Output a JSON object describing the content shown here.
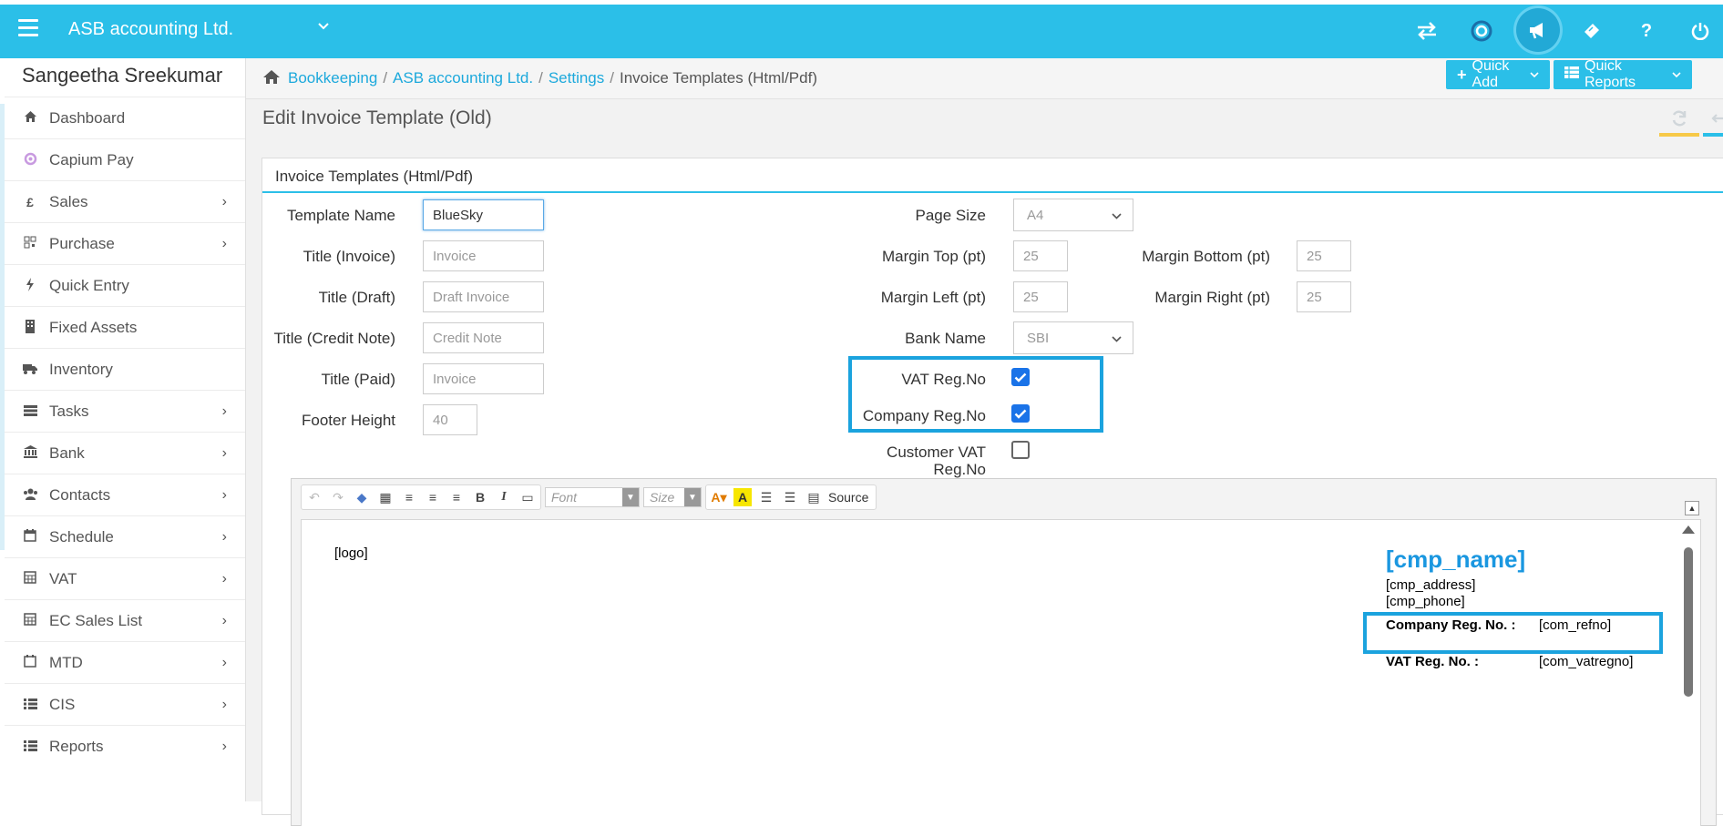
{
  "header": {
    "company": "ASB accounting Ltd.",
    "icons": [
      "exchange-icon",
      "capium-icon",
      "megaphone-icon",
      "ticket-icon",
      "help-icon",
      "power-icon"
    ]
  },
  "sidebar": {
    "user_name": "Sangeetha Sreekumar",
    "items": [
      {
        "label": "Dashboard",
        "icon": "home-icon",
        "submenu": false
      },
      {
        "label": "Capium Pay",
        "icon": "capium-icon",
        "submenu": false
      },
      {
        "label": "Sales",
        "icon": "pound-icon",
        "submenu": true
      },
      {
        "label": "Purchase",
        "icon": "barcode-icon",
        "submenu": true
      },
      {
        "label": "Quick Entry",
        "icon": "bolt-icon",
        "submenu": false
      },
      {
        "label": "Fixed Assets",
        "icon": "building-icon",
        "submenu": false
      },
      {
        "label": "Inventory",
        "icon": "truck-icon",
        "submenu": false
      },
      {
        "label": "Tasks",
        "icon": "tasks-icon",
        "submenu": true
      },
      {
        "label": "Bank",
        "icon": "bank-icon",
        "submenu": true
      },
      {
        "label": "Contacts",
        "icon": "users-icon",
        "submenu": true
      },
      {
        "label": "Schedule",
        "icon": "calendar-icon",
        "submenu": true
      },
      {
        "label": "VAT",
        "icon": "calculator-icon",
        "submenu": true
      },
      {
        "label": "EC Sales List",
        "icon": "calculator-icon",
        "submenu": true
      },
      {
        "label": "MTD",
        "icon": "calendar-icon",
        "submenu": true
      },
      {
        "label": "CIS",
        "icon": "list-icon",
        "submenu": true
      },
      {
        "label": "Reports",
        "icon": "list-icon",
        "submenu": true
      }
    ]
  },
  "breadcrumb": {
    "items": [
      "Bookkeeping",
      "ASB accounting Ltd.",
      "Settings"
    ],
    "current": "Invoice Templates (Html/Pdf)"
  },
  "actions": {
    "quick_add": "Quick Add",
    "quick_reports": "Quick Reports"
  },
  "page": {
    "title": "Edit Invoice Template (Old)",
    "panel_title": "Invoice Templates (Html/Pdf)"
  },
  "form": {
    "template_name_label": "Template Name",
    "template_name_value": "BlueSky",
    "title_invoice_label": "Title (Invoice)",
    "title_invoice_placeholder": "Invoice",
    "title_draft_label": "Title (Draft)",
    "title_draft_placeholder": "Draft Invoice",
    "title_credit_label": "Title (Credit Note)",
    "title_credit_placeholder": "Credit Note",
    "title_paid_label": "Title (Paid)",
    "title_paid_placeholder": "Invoice",
    "footer_height_label": "Footer Height",
    "footer_height_value": "40",
    "page_size_label": "Page Size",
    "page_size_value": "A4",
    "margin_top_label": "Margin Top (pt)",
    "margin_top_value": "25",
    "margin_bottom_label": "Margin Bottom (pt)",
    "margin_bottom_value": "25",
    "margin_left_label": "Margin Left (pt)",
    "margin_left_value": "25",
    "margin_right_label": "Margin Right (pt)",
    "margin_right_value": "25",
    "bank_name_label": "Bank Name",
    "bank_name_value": "SBI",
    "vat_reg_label": "VAT Reg.No",
    "vat_reg_checked": true,
    "company_reg_label": "Company Reg.No",
    "company_reg_checked": true,
    "customer_vat_label_1": "Customer VAT",
    "customer_vat_label_2": "Reg.No",
    "customer_vat_checked": false
  },
  "editor": {
    "font_placeholder": "Font",
    "size_placeholder": "Size",
    "source_label": "Source",
    "doc": {
      "logo": "[logo]",
      "cmp_name": "[cmp_name]",
      "cmp_address": "[cmp_address]",
      "cmp_phone": "[cmp_phone]",
      "company_reg_label": "Company Reg. No. :",
      "company_reg_value": "[com_refno]",
      "vat_reg_label": "VAT Reg. No. :",
      "vat_reg_value": "[com_vatregno]"
    }
  },
  "colors": {
    "brand": "#2bbfe8",
    "link": "#1da9dc",
    "highlight": "#1ba3de",
    "checkbox": "#1a73e8"
  }
}
